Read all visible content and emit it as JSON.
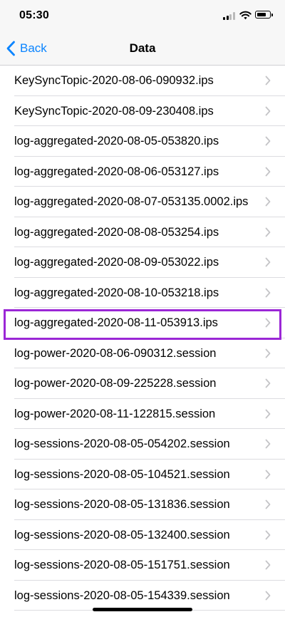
{
  "status": {
    "time": "05:30"
  },
  "nav": {
    "back_label": "Back",
    "title": "Data"
  },
  "rows": [
    "KeySyncTopic-2020-08-06-090932.ips",
    "KeySyncTopic-2020-08-09-230408.ips",
    "log-aggregated-2020-08-05-053820.ips",
    "log-aggregated-2020-08-06-053127.ips",
    "log-aggregated-2020-08-07-053135.0002.ips",
    "log-aggregated-2020-08-08-053254.ips",
    "log-aggregated-2020-08-09-053022.ips",
    "log-aggregated-2020-08-10-053218.ips",
    "log-aggregated-2020-08-11-053913.ips",
    "log-power-2020-08-06-090312.session",
    "log-power-2020-08-09-225228.session",
    "log-power-2020-08-11-122815.session",
    "log-sessions-2020-08-05-054202.session",
    "log-sessions-2020-08-05-104521.session",
    "log-sessions-2020-08-05-131836.session",
    "log-sessions-2020-08-05-132400.session",
    "log-sessions-2020-08-05-151751.session",
    "log-sessions-2020-08-05-154339.session"
  ],
  "colors": {
    "accent": "#0a84ff",
    "highlight": "#9b27d6"
  },
  "icons": {
    "back": "chevron-left-icon",
    "row": "chevron-right-icon"
  }
}
